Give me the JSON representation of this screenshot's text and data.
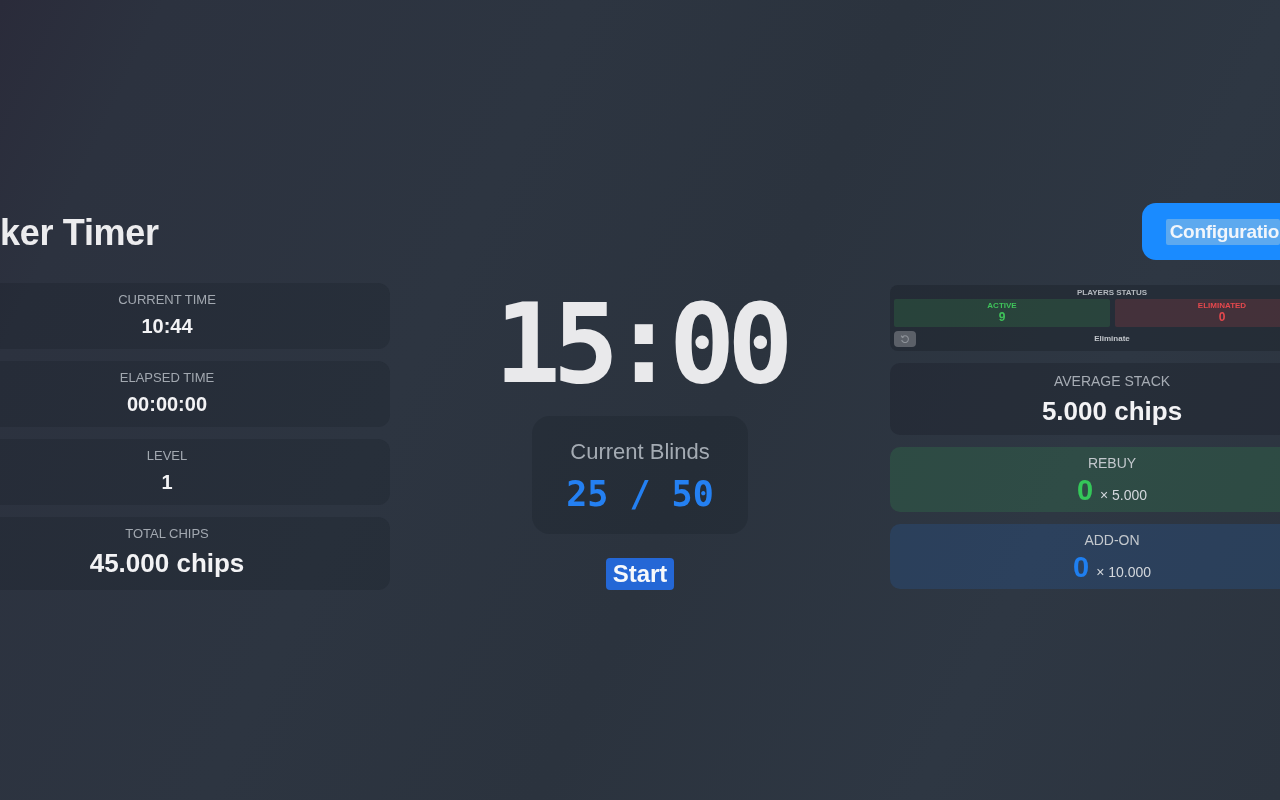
{
  "header": {
    "title": "ker Timer"
  },
  "config_button": {
    "label": "Configuratio",
    "highlighted": true
  },
  "stats": [
    {
      "label": "CURRENT TIME",
      "value": "10:44",
      "kind": "standard"
    },
    {
      "label": "ELAPSED TIME",
      "value": "00:00:00",
      "kind": "standard"
    },
    {
      "label": "LEVEL",
      "value": "1",
      "kind": "standard"
    },
    {
      "label": "TOTAL CHIPS",
      "value": "45.000 chips",
      "kind": "large"
    }
  ],
  "timer": {
    "value": "15:00"
  },
  "blinds": {
    "title": "Current Blinds",
    "value": "25 / 50"
  },
  "start_button": {
    "label": "Start"
  },
  "players_status": {
    "title": "PLAYERS STATUS",
    "counts": [
      {
        "label": "ACTIVE",
        "value": "9",
        "color": "#3fc35a"
      },
      {
        "label": "ELIMINATED",
        "value": "0",
        "color": "#e5484d"
      }
    ],
    "eliminate_label": "Eliminate"
  },
  "average_stack": {
    "label": "AVERAGE STACK",
    "value": "5.000 chips"
  },
  "counters": [
    {
      "label": "REBUY",
      "count": "0",
      "multiplier": "× 5.000",
      "color": "#34c759"
    },
    {
      "label": "ADD-ON",
      "count": "0",
      "multiplier": "× 10.000",
      "color": "#1f7ff0"
    }
  ]
}
